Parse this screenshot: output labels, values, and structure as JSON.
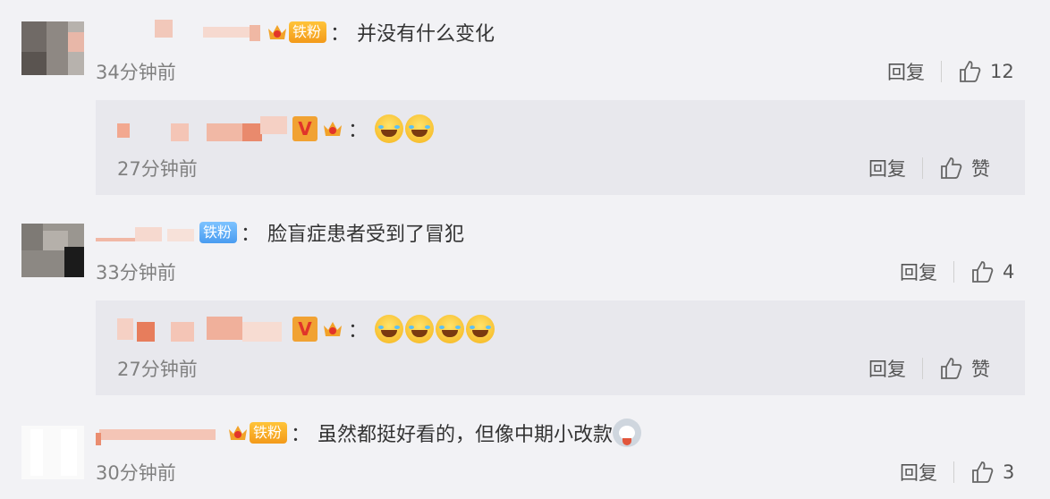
{
  "comments": [
    {
      "fan_badge": "铁粉",
      "text": "并没有什么变化",
      "time": "34分钟前",
      "reply_label": "回复",
      "likes": "12",
      "reply": {
        "time": "27分钟前",
        "reply_label": "回复",
        "likes": "赞"
      }
    },
    {
      "fan_badge": "铁粉",
      "text": "脸盲症患者受到了冒犯",
      "time": "33分钟前",
      "reply_label": "回复",
      "likes": "4",
      "reply": {
        "time": "27分钟前",
        "reply_label": "回复",
        "likes": "赞"
      }
    },
    {
      "fan_badge": "铁粉",
      "text": "虽然都挺好看的，但像中期小改款",
      "time": "30分钟前",
      "reply_label": "回复",
      "likes": "3"
    }
  ],
  "colors": {
    "username": "#eb7350",
    "meta": "#808080",
    "background": "#f2f2f5",
    "reply_bg": "#e8e8ed"
  },
  "icons": [
    "crown-badge-icon",
    "v-verified-icon",
    "thumb-up-icon",
    "laughing-crying-emoji",
    "husky-emoji"
  ]
}
